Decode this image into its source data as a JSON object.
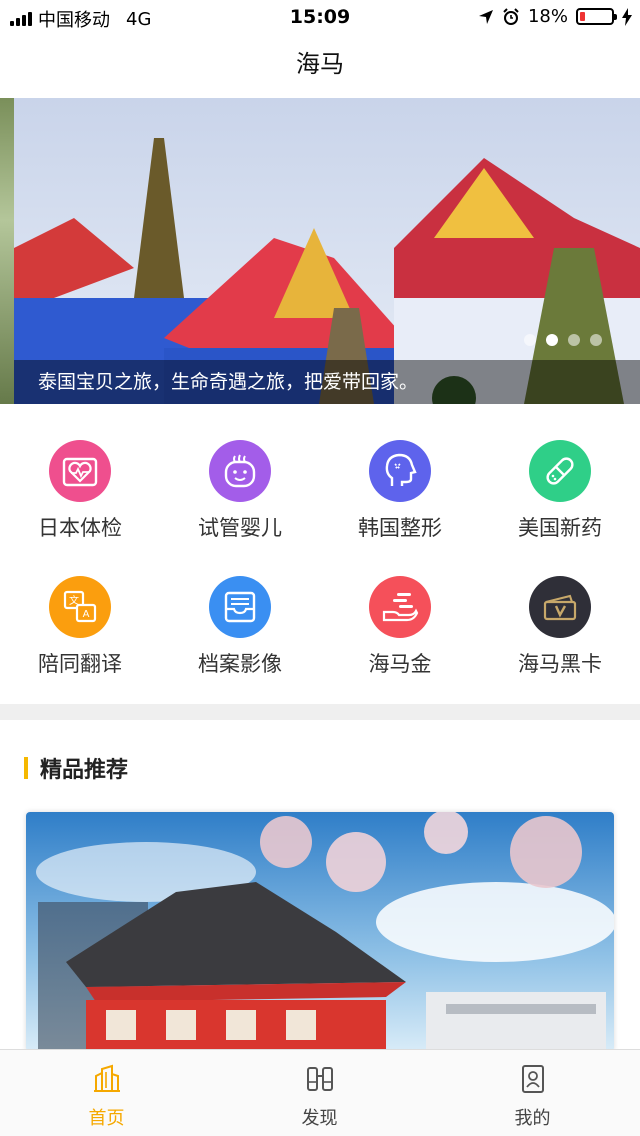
{
  "status": {
    "carrier": "中国移动",
    "network": "4G",
    "time": "15:09",
    "battery": "18%",
    "battery_level": 0.18
  },
  "nav": {
    "title": "海马"
  },
  "banner": {
    "caption": "泰国宝贝之旅，生命奇遇之旅，把爱带回家。",
    "dots": 4,
    "active_dot": 1
  },
  "services": [
    {
      "label": "日本体检",
      "icon": "heart-report-icon",
      "color": "#ef4f8e"
    },
    {
      "label": "试管婴儿",
      "icon": "baby-face-icon",
      "color": "#a35de9"
    },
    {
      "label": "韩国整形",
      "icon": "face-profile-icon",
      "color": "#5e63ec"
    },
    {
      "label": "美国新药",
      "icon": "pill-icon",
      "color": "#2fcf88"
    },
    {
      "label": "陪同翻译",
      "icon": "translate-icon",
      "color": "#fb9e0e"
    },
    {
      "label": "档案影像",
      "icon": "archive-tray-icon",
      "color": "#3a8ff2"
    },
    {
      "label": "海马金",
      "icon": "coins-hand-icon",
      "color": "#f5505a"
    },
    {
      "label": "海马黑卡",
      "icon": "black-card-icon",
      "color": "#2f2f38"
    }
  ],
  "section": {
    "title": "精品推荐"
  },
  "tabs": [
    {
      "label": "首页",
      "icon": "home-building-icon",
      "active": true
    },
    {
      "label": "发现",
      "icon": "binoculars-icon",
      "active": false
    },
    {
      "label": "我的",
      "icon": "profile-card-icon",
      "active": false
    }
  ],
  "colors": {
    "accent": "#f5b800",
    "tab_active": "#f5a800",
    "tab_inactive": "#555555"
  }
}
